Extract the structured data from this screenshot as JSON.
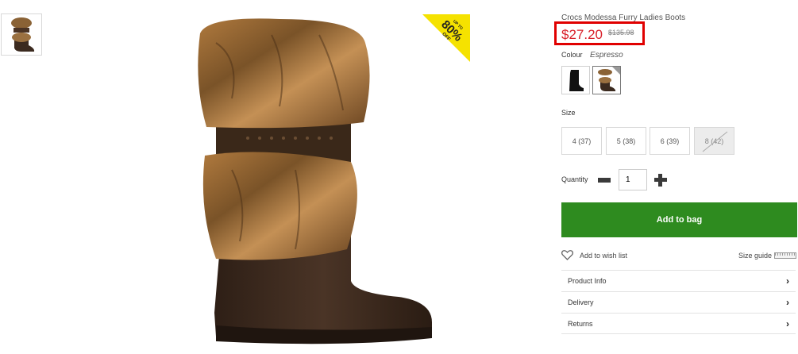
{
  "thumbnails": [
    "boot-espresso-thumbnail"
  ],
  "badge": {
    "line1": "UP TO",
    "line2": "80%",
    "line3": "OFF"
  },
  "product": {
    "title": "Crocs Modessa Furry Ladies Boots",
    "price": "$27.20",
    "old_price": "$135.98",
    "colour_label": "Colour",
    "colour_value": "Espresso",
    "swatches": [
      {
        "name": "Black",
        "selected": false
      },
      {
        "name": "Espresso",
        "selected": true
      }
    ],
    "size_label": "Size",
    "sizes": [
      {
        "label": "4 (37)",
        "available": true
      },
      {
        "label": "5 (38)",
        "available": true
      },
      {
        "label": "6 (39)",
        "available": true
      },
      {
        "label": "8 (42)",
        "available": false
      }
    ],
    "quantity_label": "Quantity",
    "quantity_value": "1",
    "add_to_bag_label": "Add to bag",
    "wishlist_label": "Add to wish list",
    "size_guide_label": "Size guide",
    "accordion": [
      "Product Info",
      "Delivery",
      "Returns"
    ]
  },
  "colors": {
    "price_red": "#d9202a",
    "highlight_red": "#e00000",
    "button_green": "#2e8b1f",
    "badge_yellow": "#f5e200"
  }
}
